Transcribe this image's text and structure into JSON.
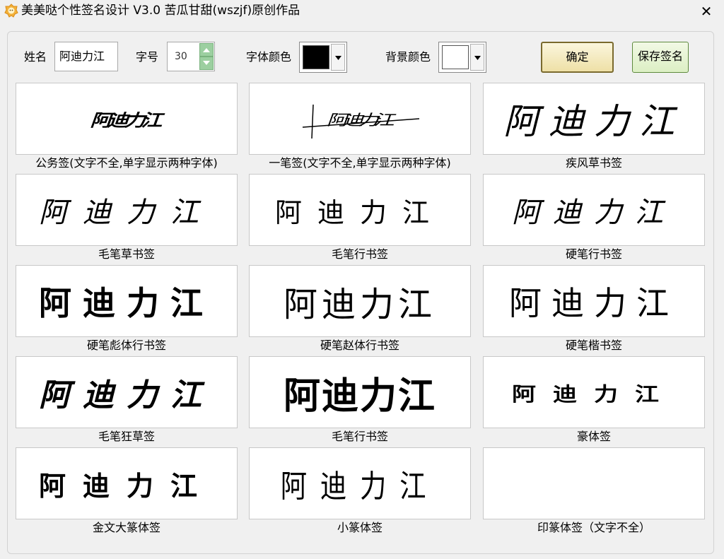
{
  "window": {
    "title": "美美哒个性签名设计 V3.0   苦瓜甘甜(wszjf)原创作品",
    "close_glyph": "✕"
  },
  "toolbar": {
    "name_label": "姓名",
    "name_value": "阿迪力江",
    "size_label": "字号",
    "size_value": "30",
    "font_color_label": "字体颜色",
    "font_color": "#000000",
    "bg_color_label": "背景颜色",
    "bg_color": "#ffffff",
    "ok_label": "确定",
    "save_label": "保存签名"
  },
  "cards": [
    {
      "caption": "公务签(文字不全,单字显示两种字体)",
      "text": "阿迪力江"
    },
    {
      "caption": "一笔签(文字不全,单字显示两种字体)",
      "text": "阿迪力江"
    },
    {
      "caption": "疾风草书签",
      "text": "阿迪力江"
    },
    {
      "caption": "毛笔草书签",
      "text": "阿迪力江"
    },
    {
      "caption": "毛笔行书签",
      "text": "阿迪力江"
    },
    {
      "caption": "硬笔行书签",
      "text": "阿迪力江"
    },
    {
      "caption": "硬笔彪体行书签",
      "text": "阿迪力江"
    },
    {
      "caption": "硬笔赵体行书签",
      "text": "阿迪力江"
    },
    {
      "caption": "硬笔楷书签",
      "text": "阿迪力江"
    },
    {
      "caption": "毛笔狂草签",
      "text": "阿迪力江"
    },
    {
      "caption": "毛笔行书签",
      "text": "阿迪力江"
    },
    {
      "caption": "豪体签",
      "text": "阿迪力江"
    },
    {
      "caption": "金文大篆体签",
      "text": "阿迪力江"
    },
    {
      "caption": "小篆体签",
      "text": "阿迪力江"
    },
    {
      "caption": "印篆体签（文字不全）",
      "text": ""
    }
  ]
}
